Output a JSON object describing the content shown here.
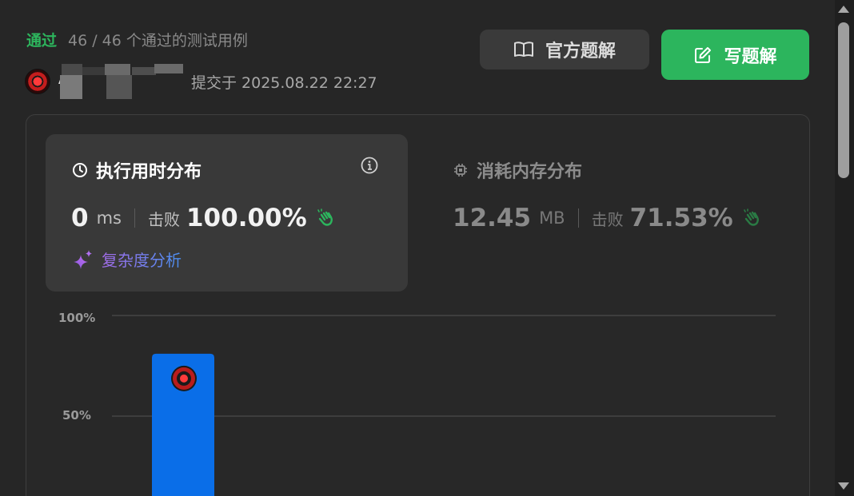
{
  "header": {
    "status": "通过",
    "cases": "46 / 46 个通过的测试用例",
    "submit_time": "提交于 2025.08.22 22:27",
    "name_initial": "A"
  },
  "buttons": {
    "official_label": "官方题解",
    "write_label": "写题解"
  },
  "runtime": {
    "title": "执行用时分布",
    "value": "0",
    "unit": "ms",
    "beat_label": "击败",
    "beat_value": "100.00%",
    "complexity_label": "复杂度分析"
  },
  "memory": {
    "title": "消耗内存分布",
    "value": "12.45",
    "unit": "MB",
    "beat_label": "击败",
    "beat_value": "71.53%"
  },
  "colors": {
    "accent_green": "#2cb55d",
    "bar_blue": "#0a6ee8",
    "complexity_gradient": [
      "#a36be8",
      "#4a8ff0"
    ]
  },
  "chart_data": {
    "type": "bar",
    "y_tick_labels": [
      "100%",
      "50%"
    ],
    "ylim": [
      0,
      100
    ],
    "bars": [
      {
        "value": 81,
        "highlighted": true
      }
    ]
  }
}
